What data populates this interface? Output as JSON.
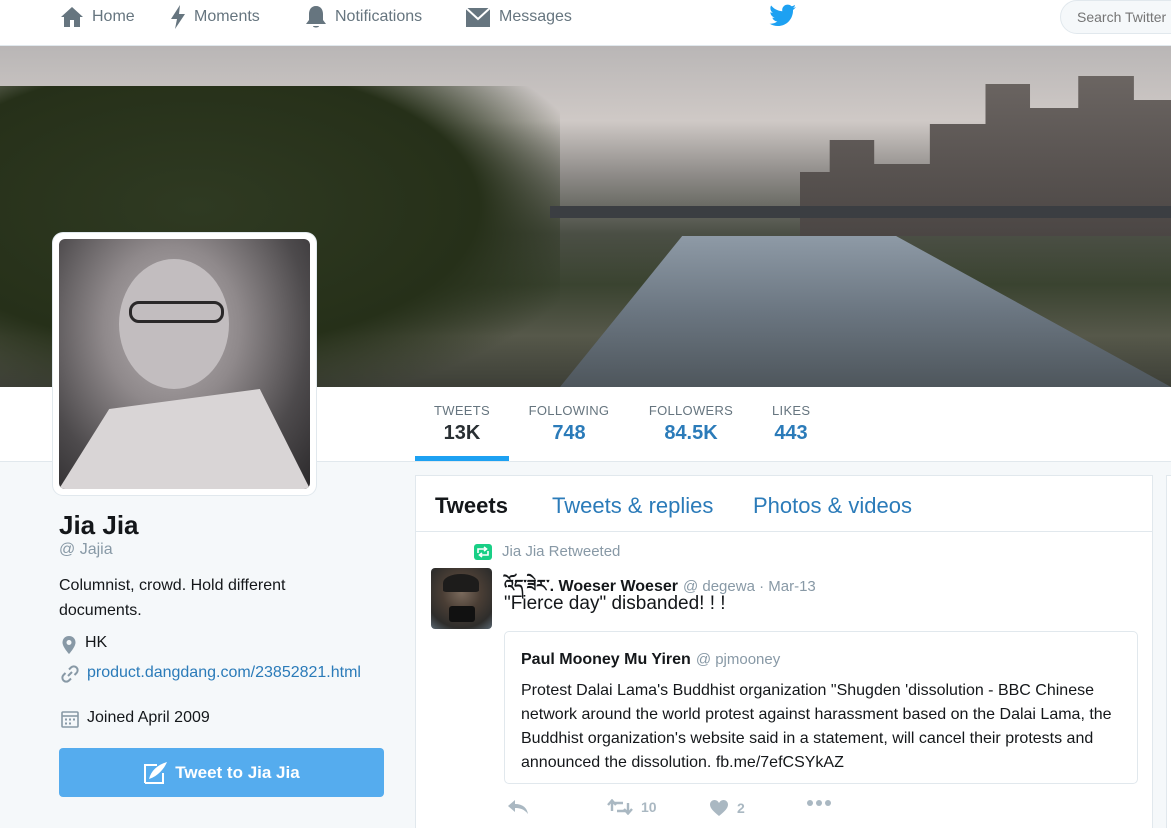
{
  "nav": {
    "home": "Home",
    "moments": "Moments",
    "notifications": "Notifications",
    "messages": "Messages",
    "search_placeholder": "Search Twitter"
  },
  "stats": {
    "tweets_label": "TWEETS",
    "tweets_value": "13K",
    "following_label": "FOLLOWING",
    "following_value": "748",
    "followers_label": "FOLLOWERS",
    "followers_value": "84.5K",
    "likes_label": "LIKES",
    "likes_value": "443"
  },
  "profile": {
    "name": "Jia Jia",
    "handle": "@ Jajia",
    "bio": "Columnist, crowd. Hold different documents.",
    "location": "HK",
    "url": "product.dangdang.com/23852821.html",
    "joined": "Joined April 2009",
    "tweet_button": "Tweet to Jia Jia"
  },
  "timeline": {
    "tabs": [
      "Tweets",
      "Tweets & replies",
      "Photos & videos"
    ],
    "tweet": {
      "retweet_note": "Jia Jia Retweeted",
      "author_name": "འོད་ཟེར་. Woeser Woeser",
      "author_handle": "@ degewa · Mar-13",
      "text": "\"Fierce day\" disbanded! ! !",
      "quote": {
        "author_name": "Paul Mooney Mu Yiren",
        "author_handle": "@ pjmooney",
        "text": "Protest Dalai Lama's Buddhist organization \"Shugden 'dissolution - BBC Chinese network around the world protest against harassment based on the Dalai Lama, the Buddhist organization's website said in a statement, will cancel their protests and announced the dissolution. fb.me/7efCSYkAZ"
      },
      "retweet_count": "10",
      "like_count": "2"
    }
  },
  "colors": {
    "accent": "#1da1f2",
    "link": "#2b7bb9",
    "button": "#55acee",
    "retweet_green": "#19cf86"
  }
}
